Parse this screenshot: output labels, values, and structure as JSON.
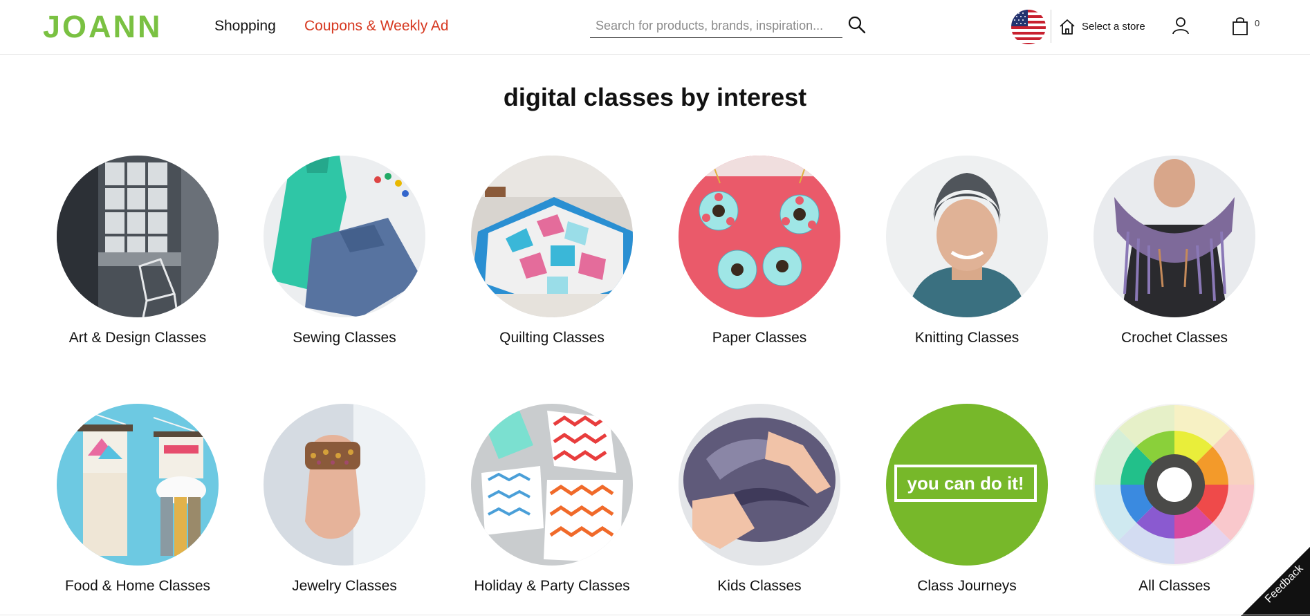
{
  "header": {
    "logo": "JOANN",
    "nav": {
      "shopping": "Shopping",
      "coupons": "Coupons & Weekly Ad"
    },
    "search": {
      "placeholder": "Search for products, brands, inspiration...",
      "value": ""
    },
    "store_label": "Select a store",
    "cart_count": "0"
  },
  "main": {
    "title": "digital classes by interest",
    "categories": [
      {
        "label": "Art & Design Classes",
        "icon": "art-design-image"
      },
      {
        "label": "Sewing Classes",
        "icon": "sewing-image"
      },
      {
        "label": "Quilting Classes",
        "icon": "quilting-image"
      },
      {
        "label": "Paper Classes",
        "icon": "paper-image"
      },
      {
        "label": "Knitting Classes",
        "icon": "knitting-image"
      },
      {
        "label": "Crochet Classes",
        "icon": "crochet-image"
      },
      {
        "label": "Food & Home Classes",
        "icon": "food-home-image"
      },
      {
        "label": "Jewelry Classes",
        "icon": "jewelry-image"
      },
      {
        "label": "Holiday & Party Classes",
        "icon": "holiday-party-image"
      },
      {
        "label": "Kids Classes",
        "icon": "kids-image"
      },
      {
        "label": "Class Journeys",
        "icon": "class-journeys-image",
        "badge_text": "you can do it!"
      },
      {
        "label": "All Classes",
        "icon": "all-classes-image"
      }
    ]
  },
  "feedback": {
    "label": "Feedback"
  },
  "colors": {
    "brand_green": "#7ac142",
    "coupon_red": "#d6371f",
    "journey_green": "#77b82a"
  }
}
